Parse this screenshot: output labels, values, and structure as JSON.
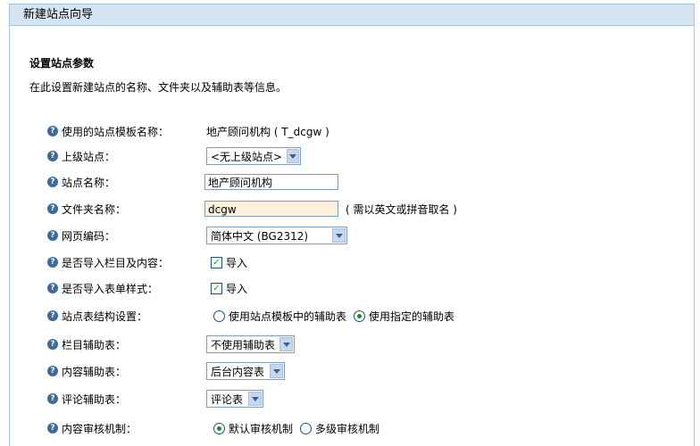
{
  "header": {
    "title": "新建站点向导"
  },
  "section": {
    "title": "设置站点参数",
    "description": "在此设置新建站点的名称、文件夹以及辅助表等信息。"
  },
  "help_glyph": "?",
  "fields": {
    "template_name": {
      "label": "使用的站点模板名称：",
      "value": "地产顾问机构 ( T_dcgw )"
    },
    "parent_site": {
      "label": "上级站点：",
      "value": "<无上级站点>"
    },
    "site_name": {
      "label": "站点名称：",
      "value": "地产顾问机构"
    },
    "folder_name": {
      "label": "文件夹名称：",
      "value": "dcgw",
      "hint": "( 需以英文或拼音取名 )"
    },
    "encoding": {
      "label": "网页编码：",
      "value": "简体中文 (BG2312)"
    },
    "import_channels": {
      "label": "是否导入栏目及内容：",
      "option": "导入",
      "checked": true
    },
    "import_forms": {
      "label": "是否导入表单样式：",
      "option": "导入",
      "checked": true
    },
    "table_structure": {
      "label": "站点表结构设置：",
      "options": [
        "使用站点模板中的辅助表",
        "使用指定的辅助表"
      ],
      "selected": 1
    },
    "channel_aux": {
      "label": "栏目辅助表：",
      "value": "不使用辅助表"
    },
    "content_aux": {
      "label": "内容辅助表：",
      "value": "后台内容表"
    },
    "comment_aux": {
      "label": "评论辅助表：",
      "value": "评论表"
    },
    "review": {
      "label": "内容审核机制：",
      "options": [
        "默认审核机制",
        "多级审核机制"
      ],
      "selected": 0
    }
  },
  "colors": {
    "header_bg": "#d7e5f3",
    "border": "#a8c3de",
    "help_icon": "#3b6a9c",
    "highlight_input": "#fdf0dd",
    "check_mark": "#21a121"
  }
}
